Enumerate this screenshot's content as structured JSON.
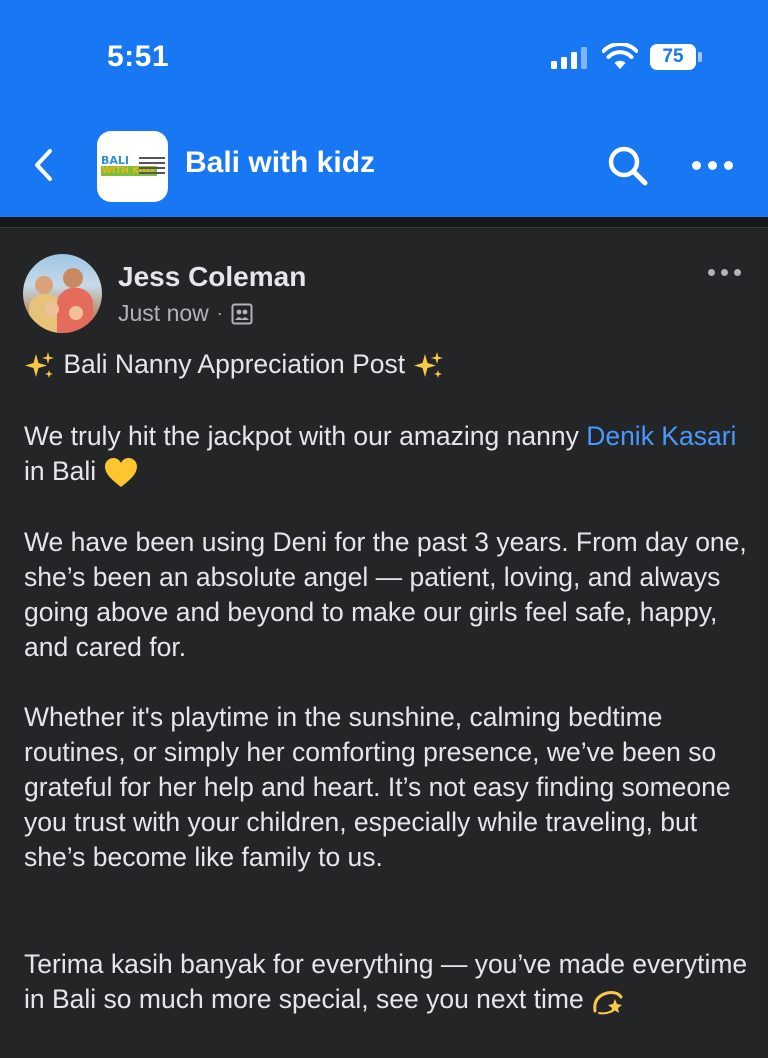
{
  "status_bar": {
    "time": "5:51",
    "battery": "75"
  },
  "header": {
    "group_name": "Bali with kidz",
    "logo_text_top": "BALI",
    "logo_text_bottom": "WITH KIDZ",
    "icons": [
      "back-chevron-icon",
      "search-icon",
      "more-icon"
    ],
    "background": "#1877F2"
  },
  "post": {
    "author": "Jess Coleman",
    "timestamp": "Just now",
    "separator": "·",
    "audience_icon": "group-audience-icon",
    "title": "Bali Nanny Appreciation Post",
    "paragraph1_before": "We truly hit the jackpot with our amazing nanny ",
    "paragraph1_mention": "Denik Kasari",
    "paragraph1_after": " in Bali",
    "paragraph2": "We have been using Deni for the past 3 years. From day one, she’s been an absolute angel — patient, loving, and always going above and beyond to make our girls feel safe, happy, and cared for.",
    "paragraph3": "Whether it's playtime in the sunshine, calming bedtime routines, or simply her comforting presence, we’ve been so grateful for her help and heart. It’s not easy finding someone you trust with your children, especially while traveling, but she’s become like family to us.",
    "paragraph4": "Terima kasih banyak for everything — you’ve made everytime in Bali so much more special, see you next time",
    "mention_color": "#4599ff"
  }
}
